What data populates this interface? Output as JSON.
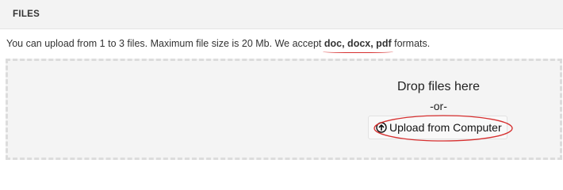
{
  "section": {
    "title": "FILES"
  },
  "info": {
    "prefix": "You can upload from 1 to 3 files. Maximum file size is 20 Mb. We accept ",
    "formats": "doc, docx, pdf",
    "suffix": " formats."
  },
  "dropzone": {
    "title": "Drop files here",
    "or_text": "-or-",
    "upload_button": {
      "label": "Upload from Computer",
      "icon": "upload-circle-icon"
    }
  },
  "colors": {
    "annotation": "#d62f2f",
    "dropzone_background": "#f4f4f4",
    "dropzone_border": "#dcdcdc"
  }
}
